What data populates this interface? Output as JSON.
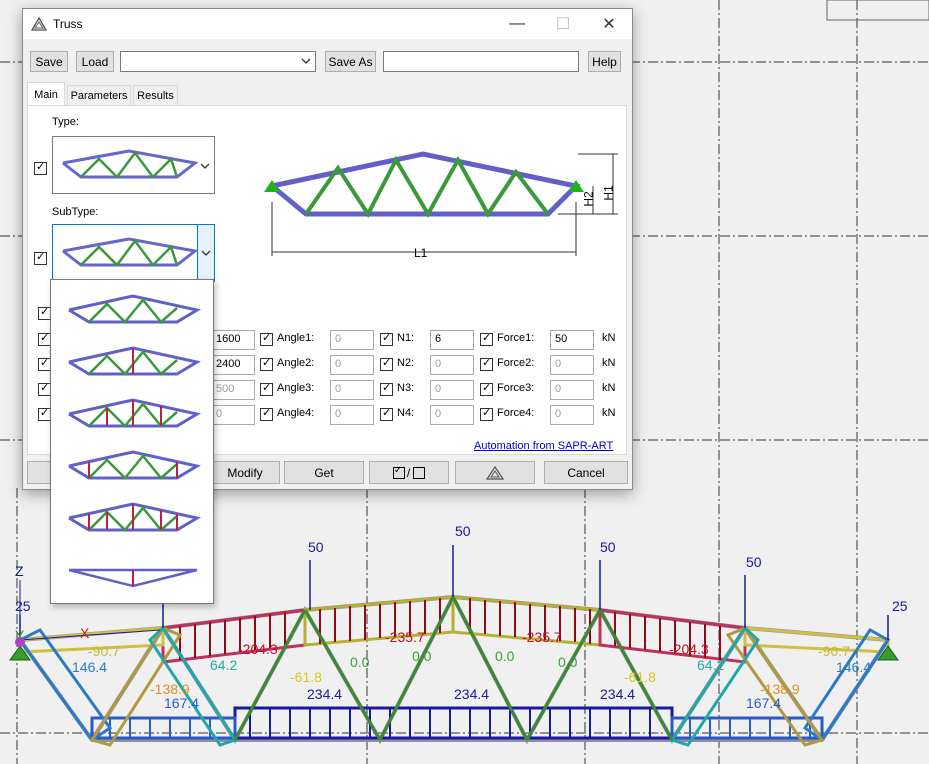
{
  "window": {
    "title": "Truss",
    "minimize": "—",
    "maximize": "☐",
    "close": "✕"
  },
  "toolbar": {
    "save": "Save",
    "load": "Load",
    "save_as": "Save As",
    "help": "Help",
    "combo_value": "",
    "name_value": ""
  },
  "tabs": [
    {
      "label": "Main"
    },
    {
      "label": "Parameters"
    },
    {
      "label": "Results"
    }
  ],
  "main": {
    "type_label": "Type:",
    "subtype_label": "SubType:",
    "diagram": {
      "l1": "L1",
      "h1": "H1",
      "h2": "H2"
    },
    "partial_values": [
      "1600",
      "2400",
      "500",
      "0"
    ],
    "angles": [
      {
        "label": "Angle1:",
        "value": "0"
      },
      {
        "label": "Angle2:",
        "value": "0"
      },
      {
        "label": "Angle3:",
        "value": "0"
      },
      {
        "label": "Angle4:",
        "value": "0"
      }
    ],
    "ns": [
      {
        "label": "N1:",
        "value": "6"
      },
      {
        "label": "N2:",
        "value": "0"
      },
      {
        "label": "N3:",
        "value": "0"
      },
      {
        "label": "N4:",
        "value": "0"
      }
    ],
    "forces": [
      {
        "label": "Force1:",
        "value": "50",
        "unit": "kN"
      },
      {
        "label": "Force2:",
        "value": "0",
        "unit": "kN"
      },
      {
        "label": "Force3:",
        "value": "0",
        "unit": "kN"
      },
      {
        "label": "Force4:",
        "value": "0",
        "unit": "kN"
      }
    ],
    "automation_link": "Automation from SAPR-ART"
  },
  "bottom": {
    "modify": "Modify",
    "get": "Get",
    "toggle": "/",
    "cancel": "Cancel"
  },
  "subtype_options": [
    "subtype-1",
    "subtype-2",
    "subtype-3",
    "subtype-4",
    "subtype-5",
    "subtype-6"
  ],
  "model": {
    "loads": [
      "50",
      "50",
      "50",
      "50",
      "25",
      "25"
    ],
    "axes": {
      "z": "Z",
      "x": "X",
      "y": "Y"
    },
    "top_chord": [
      "-90.7",
      "-204.3",
      "-235.7",
      "-235.7",
      "-204.3",
      "-90.7"
    ],
    "bottom_chord": [
      "234.4",
      "234.4",
      "234.4"
    ],
    "bottom_side": [
      "167.4",
      "167.4"
    ],
    "end_diag": [
      "146.4",
      "146.4"
    ],
    "diag_a": [
      "-138.9",
      "-138.9"
    ],
    "diag_b": [
      "64.2",
      "64.2"
    ],
    "diag_c": [
      "-61.8",
      "-61.8"
    ],
    "diag_zero": [
      "0.0",
      "0.0",
      "0.0",
      "0.0"
    ]
  }
}
